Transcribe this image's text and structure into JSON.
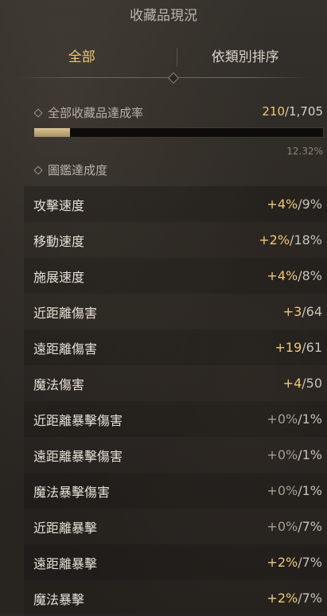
{
  "title": "收藏品現況",
  "tabs": [
    {
      "label": "全部",
      "active": true
    },
    {
      "label": "依類別排序",
      "active": false
    }
  ],
  "completion": {
    "label": "全部收藏品達成率",
    "current": "210",
    "total": "/1,705",
    "percent_text": "12.32%",
    "fill_fraction": 0.1232
  },
  "codex": {
    "label": "圖鑑達成度",
    "stats": [
      {
        "name": "攻擊速度",
        "gain": "+4%",
        "max": "9%"
      },
      {
        "name": "移動速度",
        "gain": "+2%",
        "max": "18%"
      },
      {
        "name": "施展速度",
        "gain": "+4%",
        "max": "8%"
      },
      {
        "name": "近距離傷害",
        "gain": "+3",
        "max": "64"
      },
      {
        "name": "遠距離傷害",
        "gain": "+19",
        "max": "61"
      },
      {
        "name": "魔法傷害",
        "gain": "+4",
        "max": "50"
      },
      {
        "name": "近距離暴擊傷害",
        "gain": "+0%",
        "max": "1%"
      },
      {
        "name": "遠距離暴擊傷害",
        "gain": "+0%",
        "max": "1%"
      },
      {
        "name": "魔法暴擊傷害",
        "gain": "+0%",
        "max": "1%"
      },
      {
        "name": "近距離暴擊",
        "gain": "+0%",
        "max": "7%"
      },
      {
        "name": "遠距離暴擊",
        "gain": "+2%",
        "max": "7%"
      },
      {
        "name": "魔法暴擊",
        "gain": "+2%",
        "max": "7%"
      }
    ]
  },
  "colors": {
    "accent": "#f0c878",
    "background": "#2b2724",
    "zero_value": "#a39c92"
  }
}
